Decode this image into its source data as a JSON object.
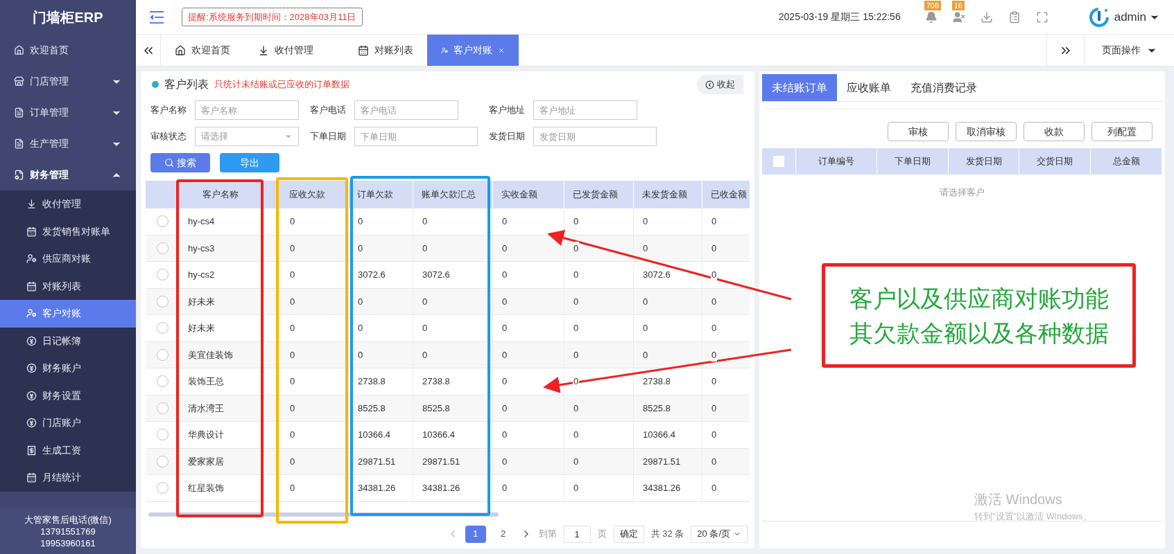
{
  "header": {
    "logo": "门墙柜ERP",
    "notice": "提醒:系统服务到期时间：2028年03月11日",
    "date": "2025-03-19",
    "weekday": "星期三",
    "time": "15:22:56",
    "badges": [
      {
        "count": "708"
      },
      {
        "count": "16"
      }
    ],
    "user": "admin"
  },
  "sidebar": {
    "items": [
      {
        "label": "欢迎首页",
        "expanded": false,
        "selected": false,
        "kind": "link"
      },
      {
        "label": "门店管理",
        "expanded": false,
        "selected": false,
        "kind": "group"
      },
      {
        "label": "订单管理",
        "expanded": false,
        "selected": false,
        "kind": "group"
      },
      {
        "label": "生产管理",
        "expanded": false,
        "selected": false,
        "kind": "group"
      },
      {
        "label": "财务管理",
        "expanded": true,
        "selected": false,
        "kind": "group",
        "children": [
          {
            "label": "收付管理",
            "selected": false
          },
          {
            "label": "发货销售对账单",
            "selected": false
          },
          {
            "label": "供应商对账",
            "selected": false
          },
          {
            "label": "对账列表",
            "selected": false
          },
          {
            "label": "客户对账",
            "selected": true
          },
          {
            "label": "日记帐簿",
            "selected": false
          },
          {
            "label": "财务账户",
            "selected": false
          },
          {
            "label": "财务设置",
            "selected": false
          },
          {
            "label": "门店账户",
            "selected": false
          },
          {
            "label": "生成工资",
            "selected": false
          },
          {
            "label": "月结统计",
            "selected": false
          }
        ]
      }
    ],
    "footer": [
      "大管家售后电话(微信)",
      "13791551769",
      "19953960161"
    ]
  },
  "tabs": [
    {
      "label": "欢迎首页",
      "selected": false
    },
    {
      "label": "收付管理",
      "selected": false
    },
    {
      "label": "对账列表",
      "selected": false
    },
    {
      "label": "客户对账",
      "selected": true
    }
  ],
  "page_actions": "页面操作",
  "customer_panel": {
    "title": "客户列表",
    "hint": "只统计未结账或已应收的订单数据",
    "collapse": "收起",
    "filters": [
      {
        "label": "客户名称",
        "placeholder": "客户名称",
        "kind": "text"
      },
      {
        "label": "客户电话",
        "placeholder": "客户电话",
        "kind": "text"
      },
      {
        "label": "客户地址",
        "placeholder": "客户地址",
        "kind": "text"
      },
      {
        "label": "审核状态",
        "placeholder": "请选择",
        "kind": "select"
      },
      {
        "label": "下单日期",
        "placeholder": "下单日期",
        "kind": "text"
      },
      {
        "label": "发货日期",
        "placeholder": "发货日期",
        "kind": "text"
      }
    ],
    "buttons": [
      {
        "label": "搜索",
        "kind": "search"
      },
      {
        "label": "导出",
        "kind": "export"
      }
    ],
    "columns": [
      "客户名称",
      "应收欠款",
      "订单欠款",
      "账单欠款汇总",
      "实收金额",
      "已发货金额",
      "未发货金额",
      "已收金额"
    ],
    "rows": [
      {
        "selected": false,
        "cells": [
          "hy-cs4",
          "0",
          "0",
          "0",
          "0",
          "0",
          "0",
          "0"
        ]
      },
      {
        "selected": false,
        "cells": [
          "hy-cs3",
          "0",
          "0",
          "0",
          "0",
          "0",
          "0",
          "0"
        ]
      },
      {
        "selected": false,
        "cells": [
          "hy-cs2",
          "0",
          "3072.6",
          "3072.6",
          "0",
          "0",
          "3072.6",
          "0"
        ]
      },
      {
        "selected": false,
        "cells": [
          "好未来",
          "0",
          "0",
          "0",
          "0",
          "0",
          "0",
          "0"
        ]
      },
      {
        "selected": false,
        "cells": [
          "好未来",
          "0",
          "0",
          "0",
          "0",
          "0",
          "0",
          "0"
        ]
      },
      {
        "selected": false,
        "cells": [
          "美宜佳装饰",
          "0",
          "0",
          "0",
          "0",
          "0",
          "0",
          "0"
        ]
      },
      {
        "selected": false,
        "cells": [
          "装饰王总",
          "0",
          "2738.8",
          "2738.8",
          "0",
          "0",
          "2738.8",
          "0"
        ]
      },
      {
        "selected": false,
        "cells": [
          "清水湾王",
          "0",
          "8525.8",
          "8525.8",
          "0",
          "0",
          "8525.8",
          "0"
        ]
      },
      {
        "selected": false,
        "cells": [
          "华典设计",
          "0",
          "10366.4",
          "10366.4",
          "0",
          "0",
          "10366.4",
          "0"
        ]
      },
      {
        "selected": false,
        "cells": [
          "爱家家居",
          "0",
          "29871.51",
          "29871.51",
          "0",
          "0",
          "29871.51",
          "0"
        ]
      },
      {
        "selected": false,
        "cells": [
          "红星装饰",
          "0",
          "34381.26",
          "34381.26",
          "0",
          "0",
          "34381.26",
          "0"
        ]
      }
    ],
    "pagination": {
      "pages": [
        {
          "label": "1",
          "selected": true
        },
        {
          "label": "2",
          "selected": false
        }
      ],
      "goto_label": "到第",
      "goto_value": "1",
      "page_unit": "页",
      "confirm": "确定",
      "total": "共 32 条",
      "page_size": "20 条/页"
    }
  },
  "order_panel": {
    "tabs": [
      {
        "label": "未结账订单",
        "selected": true
      },
      {
        "label": "应收账单",
        "selected": false
      },
      {
        "label": "充值消费记录",
        "selected": false
      }
    ],
    "buttons": [
      "审核",
      "取消审核",
      "收款",
      "列配置"
    ],
    "select_all": {
      "checked": false
    },
    "columns": [
      "订单编号",
      "下单日期",
      "发货日期",
      "交货日期",
      "总金额"
    ],
    "empty": "请选择客户"
  },
  "annotations": {
    "frames": [
      {
        "color": "#ee2222"
      },
      {
        "color": "#f5b800"
      },
      {
        "color": "#1a9af0"
      }
    ],
    "callout": [
      "客户以及供应商对账功能",
      "其欠款金额以及各种数据"
    ]
  },
  "os_notice": {
    "title": "激活 Windows",
    "subtitle": "转到\"设置\"以激活 Windows。"
  }
}
